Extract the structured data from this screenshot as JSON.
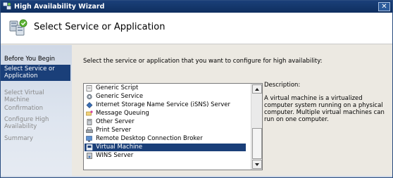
{
  "window": {
    "title": "High Availability Wizard",
    "close_glyph": "✕"
  },
  "header": {
    "heading": "Select Service or Application"
  },
  "nav": {
    "items": [
      {
        "label": "Before You Begin",
        "state": "normal"
      },
      {
        "label": "Select Service or Application",
        "state": "selected"
      },
      {
        "label": "Select Virtual Machine",
        "state": "disabled"
      },
      {
        "label": "Confirmation",
        "state": "disabled"
      },
      {
        "label": "Configure High Availability",
        "state": "disabled"
      },
      {
        "label": "Summary",
        "state": "disabled"
      }
    ]
  },
  "content": {
    "prompt": "Select the service or application that you want to configure for high availability:",
    "list": {
      "items": [
        {
          "label": "Generic Script",
          "icon": "script-icon"
        },
        {
          "label": "Generic Service",
          "icon": "service-gear-icon"
        },
        {
          "label": "Internet Storage Name Service (iSNS) Server",
          "icon": "isns-icon"
        },
        {
          "label": "Message Queuing",
          "icon": "message-queue-icon"
        },
        {
          "label": "Other Server",
          "icon": "server-icon"
        },
        {
          "label": "Print Server",
          "icon": "printer-icon"
        },
        {
          "label": "Remote Desktop Connection Broker",
          "icon": "remote-desktop-icon"
        },
        {
          "label": "Virtual Machine",
          "icon": "virtual-machine-icon"
        },
        {
          "label": "WINS Server",
          "icon": "wins-icon"
        }
      ],
      "selected": "Virtual Machine"
    },
    "description_label": "Description:",
    "description_text": "A virtual machine is a virtualized computer system running on a physical computer. Multiple virtual machines can run on one computer."
  },
  "colors": {
    "title_bar": "#1a3f79",
    "selection": "#1a3f79",
    "nav_background": "#dfe6f0",
    "dialog_background": "#ece9e2"
  }
}
